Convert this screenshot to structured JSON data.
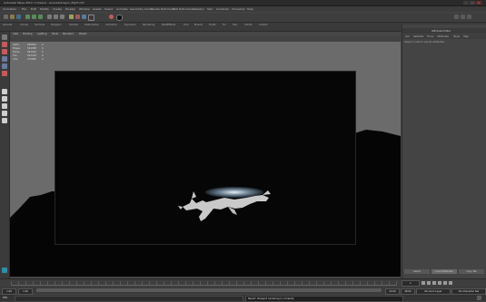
{
  "app": {
    "title": "Autodesk Maya 2014: C:\\Users\\...\\scenes\\dragon_flight.mb*",
    "window_buttons": [
      "_",
      "□",
      "×"
    ]
  },
  "menubar": {
    "mode": "Animation",
    "items": [
      "File",
      "Edit",
      "Modify",
      "Create",
      "Display",
      "Window",
      "Assets",
      "Select",
      "Animate",
      "Geometry Cache",
      "Create Deformers",
      "Edit Deformers",
      "Skeleton",
      "Skin",
      "Constrain",
      "Character",
      "Help"
    ]
  },
  "shelf": {
    "tabs": [
      "General",
      "Curves",
      "Surfaces",
      "Polygons",
      "Subdivs",
      "Deformation",
      "Animation",
      "Dynamics",
      "Rendering",
      "PaintEffects",
      "Toon",
      "Muscle",
      "Fluids",
      "Fur",
      "Hair",
      "nCloth",
      "Custom"
    ]
  },
  "viewport": {
    "menu": [
      "View",
      "Shading",
      "Lighting",
      "Show",
      "Renderer",
      "Panels"
    ],
    "hud": [
      {
        "label": "Verts:",
        "value": "262814",
        "extra": "0"
      },
      {
        "label": "Edges:",
        "value": "524388",
        "extra": "0"
      },
      {
        "label": "Faces:",
        "value": "261614",
        "extra": "0"
      },
      {
        "label": "Tris:",
        "value": "523228",
        "extra": "0"
      },
      {
        "label": "UVs:",
        "value": "274856",
        "extra": "0"
      }
    ]
  },
  "panel": {
    "title": "Attribute Editor",
    "tabs": [
      "List",
      "Selected",
      "Focus",
      "Attributes",
      "Show",
      "Help"
    ],
    "message": "Select a node to see its attributes.",
    "buttons": [
      "Select",
      "Load Attributes",
      "Copy Tab"
    ]
  },
  "timeline": {
    "current_frame": "1",
    "start": "1.00",
    "end": "24.00",
    "range_start": "1.00",
    "range_end": "48.00",
    "anim_layer": "No Anim Layer",
    "character": "No Character Set"
  },
  "commandline": {
    "label": "MEL",
    "result": "Result: Viewport rendering is complete"
  },
  "colors": {
    "gate": "#060606",
    "terrain": "#050505",
    "viewport_bg": "#6b6b6b",
    "accent_tool": "#c65a5a"
  }
}
